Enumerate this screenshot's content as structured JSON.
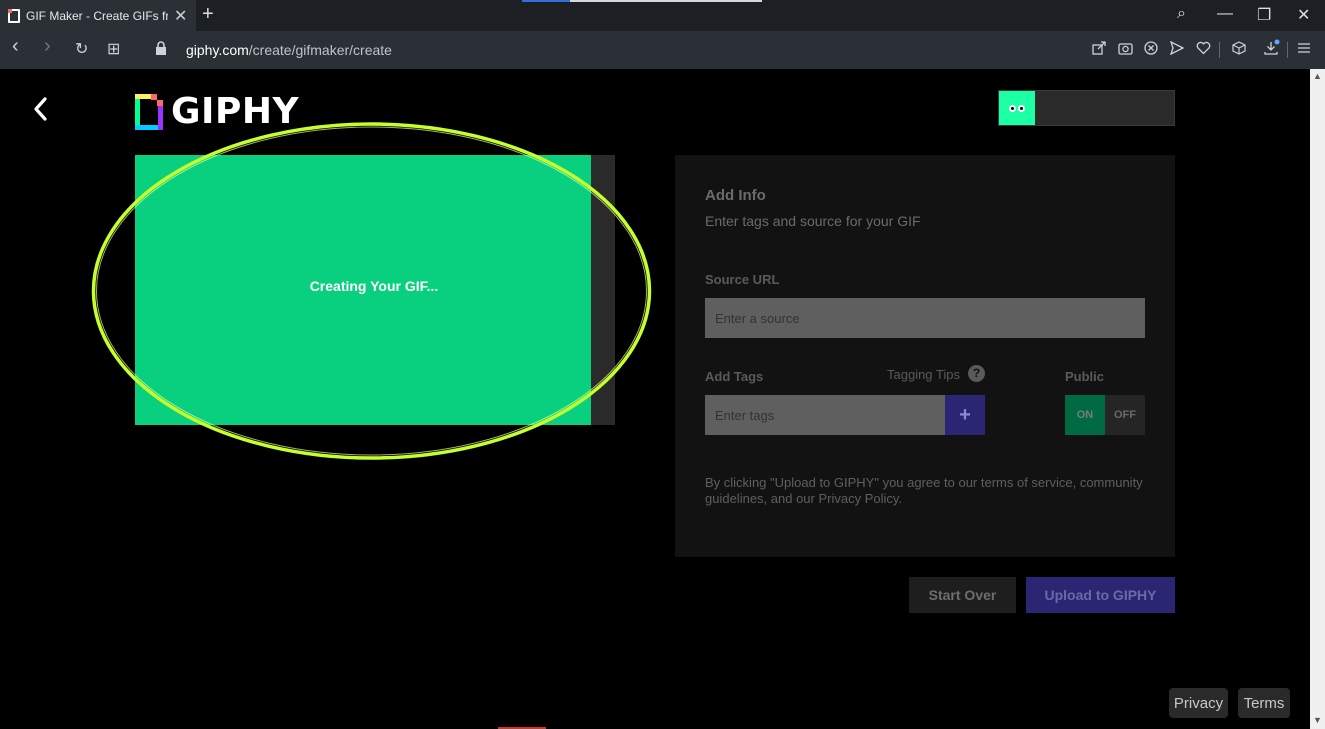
{
  "browser": {
    "tab_title": "GIF Maker - Create GIFs fro",
    "tab_close": "✕",
    "new_tab": "+",
    "url_host": "giphy.com",
    "url_path": "/create/gifmaker/create",
    "window_controls": {
      "search": "⌕",
      "minimize": "—",
      "restore": "❐",
      "close": "✕"
    },
    "nav": {
      "back": "‹",
      "forward": "›",
      "reload": "↻",
      "tabs_grid": "⊞"
    },
    "toolbar_icons": [
      "share-icon",
      "camera-icon",
      "block-icon",
      "send-icon",
      "heart-icon",
      "cube-icon",
      "download-icon",
      "menu-icon"
    ]
  },
  "header": {
    "logo_text": "GIPHY"
  },
  "preview": {
    "status_text": "Creating Your GIF..."
  },
  "panel": {
    "title": "Add Info",
    "subtitle": "Enter tags and source for your GIF",
    "source_label": "Source URL",
    "source_placeholder": "Enter a source",
    "tags_label": "Add Tags",
    "tagging_tips": "Tagging Tips",
    "help_symbol": "?",
    "tags_placeholder": "Enter tags",
    "add_tag_symbol": "+",
    "public_label": "Public",
    "toggle_on": "ON",
    "toggle_off": "OFF",
    "disclaimer": "By clicking \"Upload to GIPHY\" you agree to our terms of service, community guidelines, and our Privacy Policy."
  },
  "actions": {
    "start_over": "Start Over",
    "upload": "Upload to GIPHY"
  },
  "footer": {
    "privacy": "Privacy",
    "terms": "Terms"
  },
  "colors": {
    "preview_green": "#09d07f",
    "highlight_ring": "#c6ff2e",
    "upload_blue": "#2a2673",
    "toggle_on_green": "#006b42"
  }
}
